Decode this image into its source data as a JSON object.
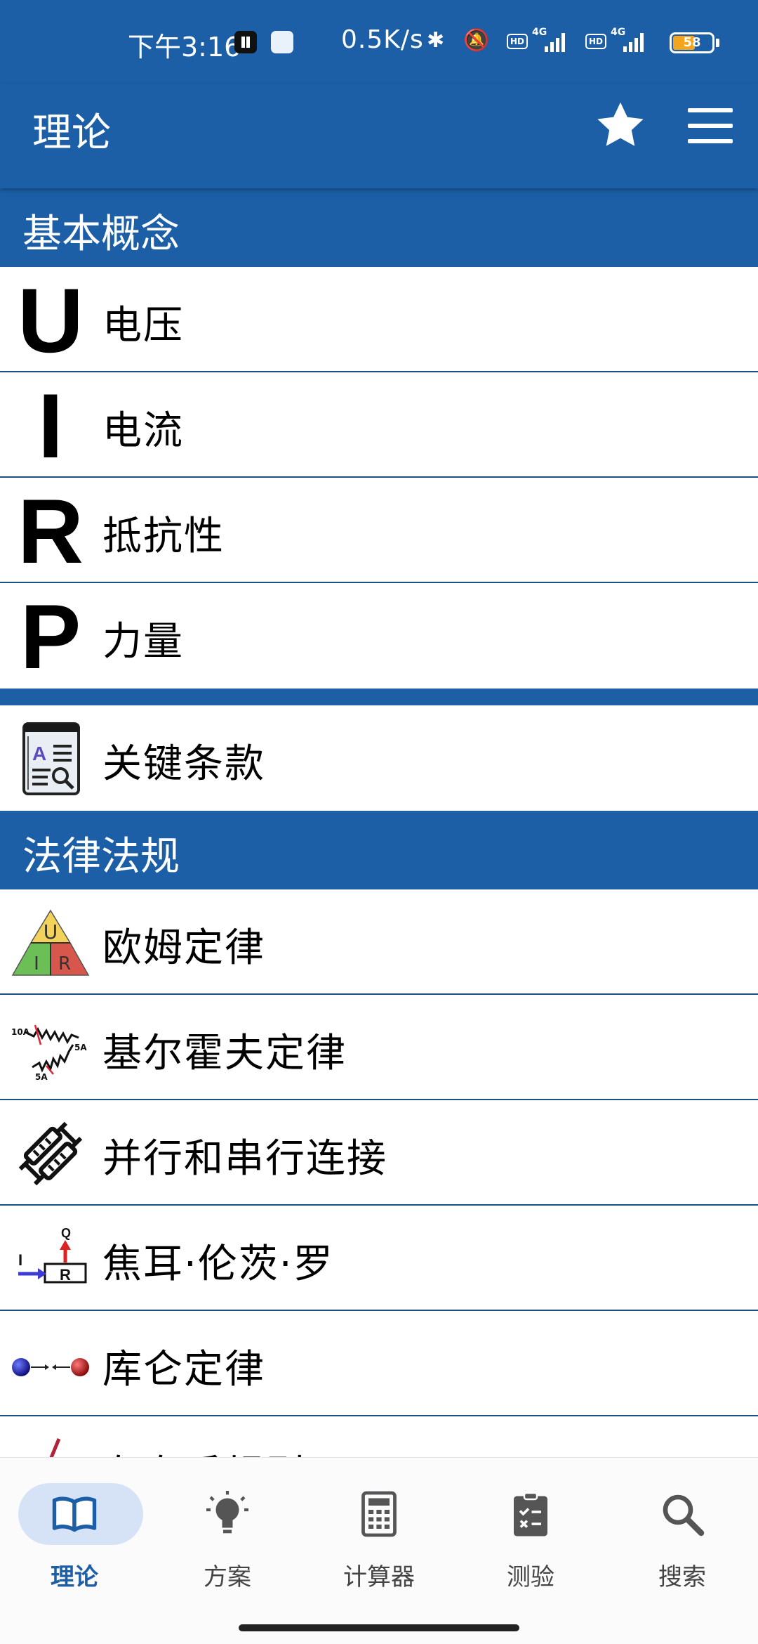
{
  "status_bar": {
    "time": "下午3:16",
    "speed": "0.5K/s",
    "battery": "58",
    "battery_level": 0.58,
    "hd_label": "HD",
    "net_label": "4G"
  },
  "app_bar": {
    "title": "理论"
  },
  "sections": [
    {
      "title": "基本概念",
      "items": [
        {
          "icon": "U",
          "label": "电压"
        },
        {
          "icon": "I",
          "label": "电流"
        },
        {
          "icon": "R",
          "label": "抵抗性"
        },
        {
          "icon": "P",
          "label": "力量"
        }
      ]
    },
    {
      "title": "",
      "items": [
        {
          "icon": "key-terms-book-icon",
          "label": "关键条款"
        }
      ]
    },
    {
      "title": "法律法规",
      "items": [
        {
          "icon": "ohms-law-triangle-icon",
          "label": "欧姆定律",
          "icon_text": [
            "U",
            "I",
            "R"
          ]
        },
        {
          "icon": "kirchhoff-circuit-icon",
          "label": "基尔霍夫定律",
          "icon_text": [
            "10A",
            "5A",
            "5A"
          ]
        },
        {
          "icon": "resistors-connection-icon",
          "label": "并行和串行连接"
        },
        {
          "icon": "joule-heating-icon",
          "label": "焦耳·伦茨·罗",
          "icon_text": [
            "I",
            "Q",
            "R"
          ]
        },
        {
          "icon": "coulomb-charges-icon",
          "label": "库仑定律"
        },
        {
          "icon": "left-hand-rule-icon",
          "label": "左右手规则"
        }
      ]
    }
  ],
  "bottom_nav": [
    {
      "label": "理论",
      "icon": "book-icon",
      "active": true
    },
    {
      "label": "方案",
      "icon": "lightbulb-icon",
      "active": false
    },
    {
      "label": "计算器",
      "icon": "calculator-icon",
      "active": false
    },
    {
      "label": "测验",
      "icon": "clipboard-icon",
      "active": false
    },
    {
      "label": "搜索",
      "icon": "search-icon",
      "active": false
    }
  ],
  "colors": {
    "primary": "#1c5fa6",
    "divider": "#1c4f85",
    "nav_pill": "#d6e3f7",
    "battery": "#f3a51e"
  }
}
